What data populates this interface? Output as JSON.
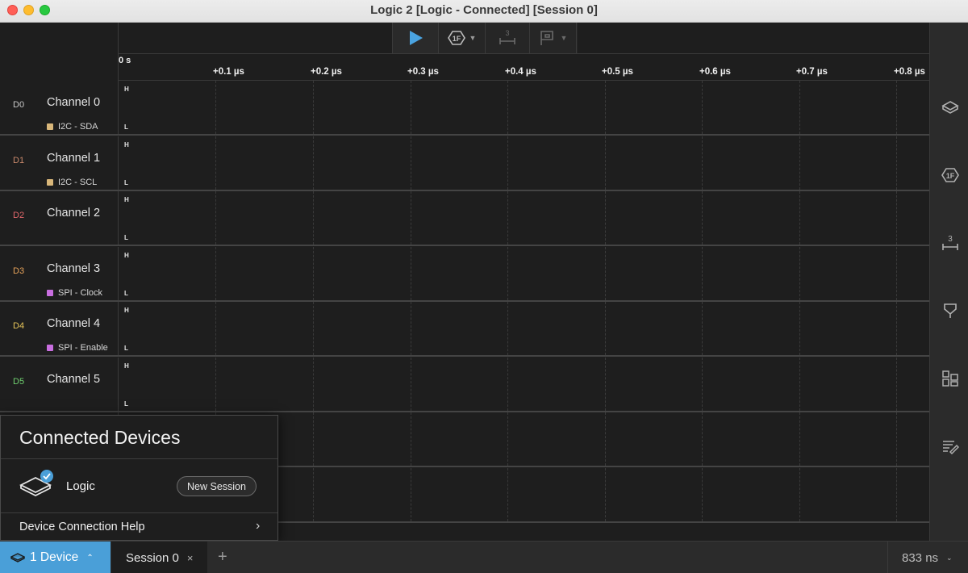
{
  "window": {
    "title": "Logic 2 [Logic - Connected] [Session 0]"
  },
  "toolbar": {
    "play": {
      "icon": "play-icon"
    },
    "trigger": {
      "icon": "trigger-icon",
      "icon_text": "1F"
    },
    "measure": {
      "icon": "measure-icon",
      "icon_text": "3"
    },
    "marker": {
      "icon": "marker-flag-icon"
    }
  },
  "ruler": {
    "start": "0 s",
    "ticks": [
      "+0.1 µs",
      "+0.2 µs",
      "+0.3 µs",
      "+0.4 µs",
      "+0.5 µs",
      "+0.6 µs",
      "+0.7 µs",
      "+0.8 µs"
    ]
  },
  "channels": [
    {
      "id": "D0",
      "name": "Channel 0",
      "protocol": "I2C - SDA",
      "id_color": "#c8c8c8",
      "proto_color": "#d9b77a"
    },
    {
      "id": "D1",
      "name": "Channel 1",
      "protocol": "I2C - SCL",
      "id_color": "#c9896b",
      "proto_color": "#d9b77a"
    },
    {
      "id": "D2",
      "name": "Channel 2",
      "protocol": "",
      "id_color": "#e0676b",
      "proto_color": ""
    },
    {
      "id": "D3",
      "name": "Channel 3",
      "protocol": "SPI - Clock",
      "id_color": "#e6a25a",
      "proto_color": "#c96ee0"
    },
    {
      "id": "D4",
      "name": "Channel 4",
      "protocol": "SPI - Enable",
      "id_color": "#e6c55a",
      "proto_color": "#c96ee0"
    },
    {
      "id": "D5",
      "name": "Channel 5",
      "protocol": "",
      "id_color": "#6fcf6f",
      "proto_color": ""
    }
  ],
  "level_labels": {
    "high": "H",
    "low": "L"
  },
  "sidebar": {
    "items": [
      {
        "icon": "devices-icon"
      },
      {
        "icon": "trigger-icon",
        "icon_text": "1F"
      },
      {
        "icon": "measurements-icon",
        "icon_text": "3"
      },
      {
        "icon": "marker-icon"
      },
      {
        "icon": "extensions-icon"
      },
      {
        "icon": "notes-icon"
      }
    ]
  },
  "popup": {
    "title": "Connected Devices",
    "device_name": "Logic",
    "new_session_label": "New Session",
    "help_label": "Device Connection Help",
    "help_chevron": "›"
  },
  "bottombar": {
    "device_button_label": "1 Device",
    "device_button_chevron": "⌃",
    "session_tab_label": "Session 0",
    "session_close": "×",
    "add_tab": "+",
    "zoom_label": "833 ns",
    "zoom_chevron": "⌄"
  },
  "colors": {
    "accent": "#4a9fd8",
    "background": "#1e1e1e",
    "panel": "#2b2b2b"
  }
}
